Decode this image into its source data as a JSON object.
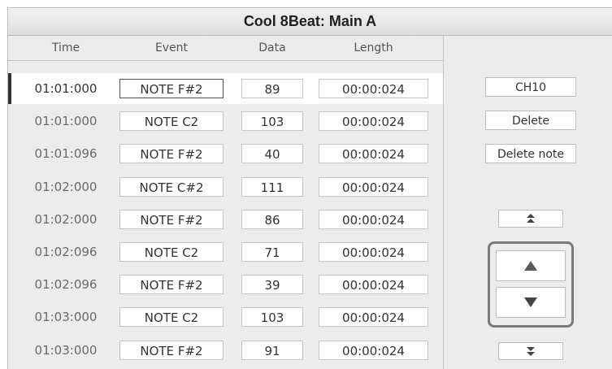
{
  "window": {
    "title": "Cool 8Beat: Main A"
  },
  "columns": {
    "time": "Time",
    "event": "Event",
    "data": "Data",
    "length": "Length"
  },
  "rows": [
    {
      "time": "01:01:000",
      "event": "NOTE F#2",
      "data": "89",
      "length": "00:00:024"
    },
    {
      "time": "01:01:000",
      "event": "NOTE C2",
      "data": "103",
      "length": "00:00:024"
    },
    {
      "time": "01:01:096",
      "event": "NOTE F#2",
      "data": "40",
      "length": "00:00:024"
    },
    {
      "time": "01:02:000",
      "event": "NOTE C#2",
      "data": "111",
      "length": "00:00:024"
    },
    {
      "time": "01:02:000",
      "event": "NOTE F#2",
      "data": "86",
      "length": "00:00:024"
    },
    {
      "time": "01:02:096",
      "event": "NOTE C2",
      "data": "71",
      "length": "00:00:024"
    },
    {
      "time": "01:02:096",
      "event": "NOTE F#2",
      "data": "39",
      "length": "00:00:024"
    },
    {
      "time": "01:03:000",
      "event": "NOTE C2",
      "data": "103",
      "length": "00:00:024"
    },
    {
      "time": "01:03:000",
      "event": "NOTE F#2",
      "data": "91",
      "length": "00:00:024"
    }
  ],
  "selected_row": 0,
  "sidebar": {
    "channel_label": "CH10",
    "delete_label": "Delete",
    "delete_note_label": "Delete note"
  },
  "icons": {
    "page_up": "double-chevron-up-icon",
    "up": "triangle-up-icon",
    "down": "triangle-down-icon",
    "page_down": "double-chevron-down-icon"
  },
  "colors": {
    "panel_bg": "#ececec",
    "selected_row_bg": "#ffffff",
    "highlight_border": "#7a7a7a"
  }
}
